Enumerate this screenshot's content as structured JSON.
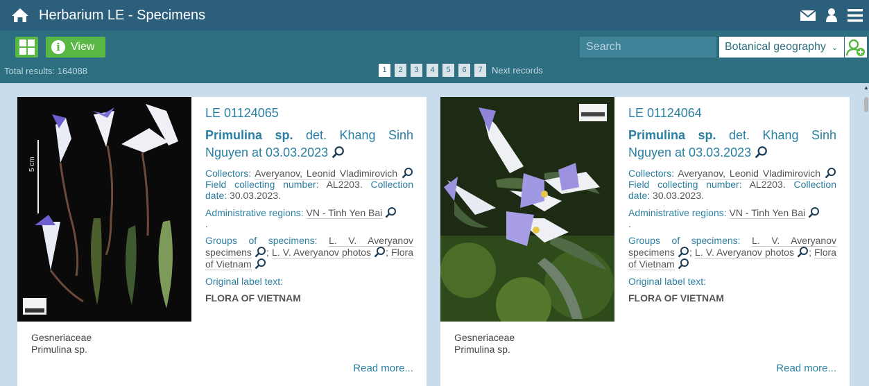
{
  "header": {
    "title": "Herbarium LE - Specimens",
    "icons": [
      "home-icon",
      "mail-icon",
      "user-icon",
      "menu-icon"
    ]
  },
  "toolbar": {
    "view_label": "View",
    "search_placeholder": "Search",
    "geo_select_value": "Botanical geography",
    "total_results": "Total results: 164088",
    "pages": [
      "1",
      "2",
      "3",
      "4",
      "5",
      "6",
      "7"
    ],
    "next_label": "Next records"
  },
  "colors": {
    "header_bg": "#2c5f7c",
    "toolbar_bg": "#2d6e80",
    "button_green": "#59b844",
    "link_blue": "#2a7fa2",
    "page_bg": "#c9dcec"
  },
  "cards": [
    {
      "catalog_no": "LE 01124065",
      "taxon": "Primulina sp.",
      "det_text": "det. Khang Sinh Nguyen at 03.03.2023",
      "collectors_label": "Collectors:",
      "collectors_value": "Averyanov, Leonid Vladimirovich",
      "field_no_label": "Field collecting number:",
      "field_no_value": "AL2203.",
      "date_label": "Collection date:",
      "date_value": "30.03.2023.",
      "admin_label": "Administrative regions:",
      "admin_value": "VN - Tinh Yen Bai",
      "admin_end": ".",
      "groups_label": "Groups of specimens:",
      "group1": "L. V. Averyanov specimens",
      "group2": "L. V. Averyanov photos",
      "group3": "Flora of Vietnam",
      "orig_label": "Original label text:",
      "orig_text": "FLORA OF VIETNAM",
      "family": "Gesneriaceae",
      "taxon_caption": "Primulina sp.",
      "scale_text": "5 cm",
      "read_more": "Read more..."
    },
    {
      "catalog_no": "LE 01124064",
      "taxon": "Primulina sp.",
      "det_text": "det. Khang Sinh Nguyen at 03.03.2023",
      "collectors_label": "Collectors:",
      "collectors_value": "Averyanov, Leonid Vladimirovich",
      "field_no_label": "Field collecting number:",
      "field_no_value": "AL2203.",
      "date_label": "Collection date:",
      "date_value": "30.03.2023.",
      "admin_label": "Administrative regions:",
      "admin_value": "VN - Tinh Yen Bai",
      "admin_end": ".",
      "groups_label": "Groups of specimens:",
      "group1": "L. V. Averyanov specimens",
      "group2": "L. V. Averyanov photos",
      "group3": "Flora of Vietnam",
      "orig_label": "Original label text:",
      "orig_text": "FLORA OF VIETNAM",
      "family": "Gesneriaceae",
      "taxon_caption": "Primulina sp.",
      "read_more": "Read more..."
    }
  ]
}
